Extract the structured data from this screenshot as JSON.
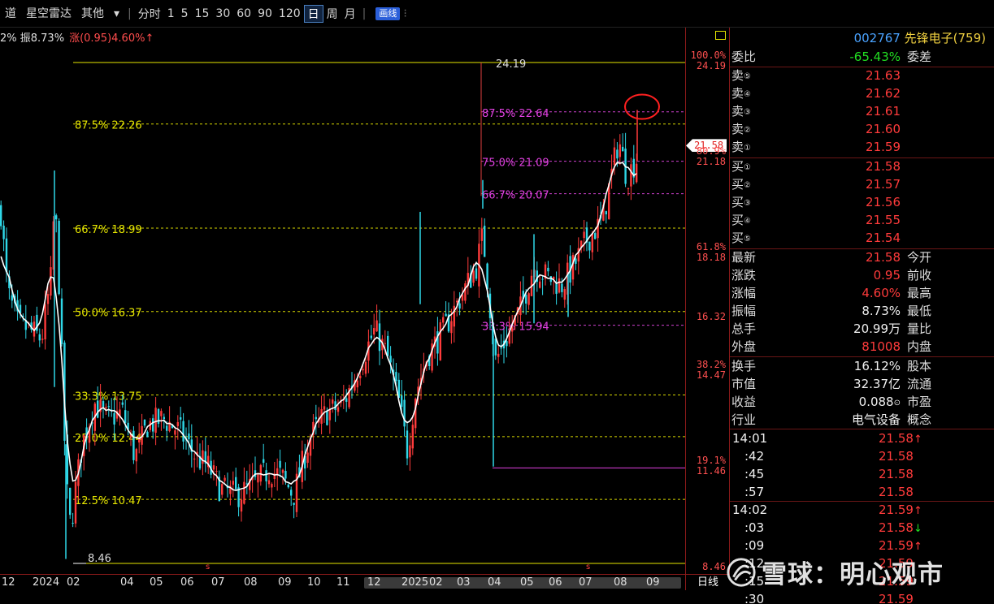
{
  "toolbar": {
    "items": [
      "道",
      "星空雷达",
      "其他",
      "▾",
      "|",
      "分时",
      "1",
      "5",
      "15",
      "30",
      "60",
      "90",
      "120",
      "日",
      "周",
      "月",
      "|",
      "画线",
      "⁝"
    ],
    "active_period": "日"
  },
  "info_line": {
    "amplitude": "2% 振8.73%",
    "change": "涨(0.95)4.60%↑"
  },
  "chart": {
    "fib_left": [
      {
        "label": "87.5% 22.26",
        "price": 22.26
      },
      {
        "label": "66.7% 18.99",
        "price": 18.99
      },
      {
        "label": "50.0% 16.37",
        "price": 16.37
      },
      {
        "label": "33.3% 13.75",
        "price": 13.75
      },
      {
        "label": "25.0% 12.44",
        "price": 12.44
      },
      {
        "label": "12.5% 10.47",
        "price": 10.47
      }
    ],
    "fib_right": [
      {
        "label": "87.5% 22.64",
        "price": 22.64
      },
      {
        "label": "75.0% 21.09",
        "price": 21.09
      },
      {
        "label": "66.7% 20.07",
        "price": 20.07
      },
      {
        "label": "33.3% 15.94",
        "price": 15.94
      }
    ],
    "high_label": "24.19",
    "low_label": "8.46",
    "signal_marks": [
      "s",
      "s"
    ]
  },
  "price_axis": {
    "labels": [
      {
        "pct": "100.0%",
        "price": "24.19",
        "y": 24.19
      },
      {
        "pct": "80.9%",
        "price": "21.18",
        "y": 21.18
      },
      {
        "pct": "61.8%",
        "price": "18.18",
        "y": 18.18
      },
      {
        "pct": "",
        "price": "16.32",
        "y": 16.32
      },
      {
        "pct": "38.2%",
        "price": "14.47",
        "y": 14.47
      },
      {
        "pct": "19.1%",
        "price": "11.46",
        "y": 11.46
      },
      {
        "pct": "",
        "price": "8.46",
        "y": 8.46
      }
    ],
    "current": "21.58",
    "current_price": 21.58
  },
  "date_axis": {
    "labels": [
      "12",
      "2024",
      "02",
      "04",
      "05",
      "06",
      "07",
      "08",
      "09",
      "10",
      "11",
      "12",
      "2025",
      "02",
      "03",
      "04",
      "05",
      "06",
      "07",
      "08",
      "09"
    ],
    "dayline": "日线"
  },
  "panel": {
    "code": "002767",
    "name": "先锋电子",
    "count": "(759)",
    "ratio": {
      "label": "委比",
      "value": "-65.43%",
      "label2": "委差"
    },
    "asks": [
      {
        "label": "卖",
        "n": "⑤",
        "price": "21.63"
      },
      {
        "label": "卖",
        "n": "④",
        "price": "21.62"
      },
      {
        "label": "卖",
        "n": "③",
        "price": "21.61"
      },
      {
        "label": "卖",
        "n": "②",
        "price": "21.60"
      },
      {
        "label": "卖",
        "n": "①",
        "price": "21.59"
      }
    ],
    "bids": [
      {
        "label": "买",
        "n": "①",
        "price": "21.58"
      },
      {
        "label": "买",
        "n": "②",
        "price": "21.57"
      },
      {
        "label": "买",
        "n": "③",
        "price": "21.56"
      },
      {
        "label": "买",
        "n": "④",
        "price": "21.55"
      },
      {
        "label": "买",
        "n": "⑤",
        "price": "21.54"
      }
    ],
    "stats": [
      {
        "label": "最新",
        "value": "21.58",
        "label2": "今开",
        "cls": "red",
        "lcls": "yellow"
      },
      {
        "label": "涨跌",
        "value": "0.95",
        "label2": "前收",
        "cls": "red",
        "lcls": ""
      },
      {
        "label": "涨幅",
        "value": "4.60%",
        "label2": "最高",
        "cls": "red",
        "lcls": ""
      },
      {
        "label": "振幅",
        "value": "8.73%",
        "label2": "最低",
        "cls": "white",
        "lcls": ""
      },
      {
        "label": "总手",
        "value": "20.99万",
        "label2": "量比",
        "cls": "white",
        "lcls": ""
      },
      {
        "label": "外盘",
        "value": "81008",
        "label2": "内盘",
        "cls": "red",
        "lcls": ""
      }
    ],
    "stats2": [
      {
        "label": "换手",
        "value": "16.12%",
        "label2": "股本",
        "cls": "white",
        "lcls": ""
      },
      {
        "label": "市值",
        "value": "32.37亿",
        "label2": "流通",
        "cls": "white",
        "lcls": ""
      },
      {
        "label": "收益",
        "value": "0.088",
        "suffix": "⊙",
        "label2": "市盈",
        "cls": "white",
        "lcls": ""
      },
      {
        "label": "行业",
        "value": "电气设备",
        "label2": "概念",
        "cls": "white",
        "lcls": "yellow"
      }
    ],
    "ticks": [
      {
        "time": "14:01",
        "price": "21.58",
        "arrow": "↑",
        "acls": "red"
      },
      {
        "time": ":42",
        "price": "21.58",
        "arrow": "",
        "acls": ""
      },
      {
        "time": ":45",
        "price": "21.58",
        "arrow": "",
        "acls": ""
      },
      {
        "time": ":57",
        "price": "21.58",
        "arrow": "",
        "acls": ""
      },
      {
        "time": "14:02",
        "price": "21.59",
        "arrow": "↑",
        "acls": "red"
      },
      {
        "time": ":03",
        "price": "21.58",
        "arrow": "↓",
        "acls": "green"
      },
      {
        "time": ":09",
        "price": "21.59",
        "arrow": "↑",
        "acls": "red"
      },
      {
        "time": ":12",
        "price": "21.59",
        "arrow": "",
        "acls": ""
      },
      {
        "time": ":15",
        "price": "21.59",
        "arrow": "",
        "acls": ""
      },
      {
        "time": ":30",
        "price": "21.59",
        "arrow": "",
        "acls": ""
      }
    ]
  },
  "watermark": "雪球：明心观市",
  "colors": {
    "up": "#ff3b3b",
    "down": "#22dd22",
    "fib_yellow": "#e6e600",
    "fib_magenta": "#e040e0",
    "ma": "#ffffff"
  }
}
